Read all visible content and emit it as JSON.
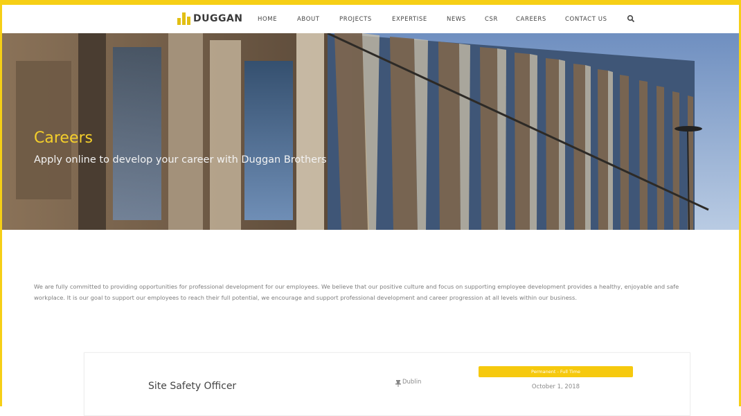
{
  "brand": {
    "name": "DUGGAN",
    "accent": "#f6cf16"
  },
  "nav": {
    "items": [
      "HOME",
      "ABOUT",
      "PROJECTS",
      "EXPERTISE",
      "NEWS",
      "CSR",
      "CAREERS",
      "CONTACT US"
    ],
    "search_icon": "search-icon"
  },
  "hero": {
    "title": "Careers",
    "subtitle": "Apply online to develop your career with Duggan Brothers"
  },
  "intro": {
    "text": "We are fully committed to providing opportunities for professional development for our employees. We believe that our positive culture and focus on supporting employee development provides a healthy, enjoyable and safe workplace. It is our goal to support our employees to reach their full potential, we encourage and support professional development and career progression at all levels within our business."
  },
  "jobs": [
    {
      "title": "Site Safety Officer",
      "location": "Dublin",
      "type": "Permanent - Full Time",
      "date": "October 1, 2018"
    }
  ]
}
